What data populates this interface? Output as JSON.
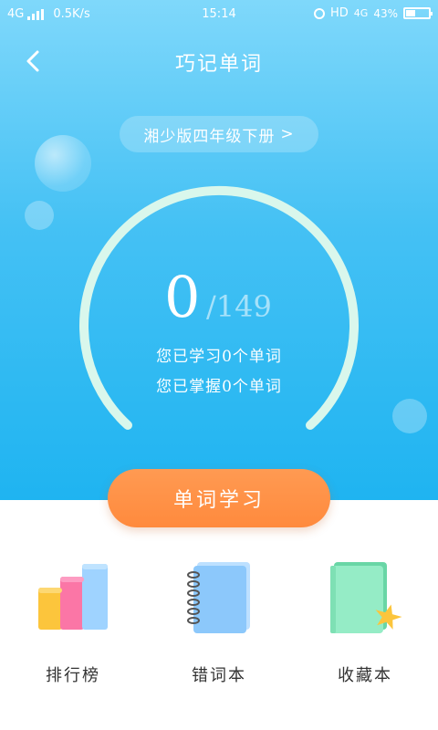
{
  "status_bar": {
    "network": "4G",
    "speed": "0.5K/s",
    "time": "15:14",
    "hd": "HD",
    "network2": "4G",
    "battery_text": "43%",
    "battery_level": 0.43
  },
  "header": {
    "title": "巧记单词"
  },
  "book_selector": {
    "label": "湘少版四年级下册",
    "chevron": ">"
  },
  "progress": {
    "learned": "0",
    "total": "/149",
    "learned_text": "您已学习0个单词",
    "mastered_text": "您已掌握0个单词"
  },
  "actions": {
    "study_label": "单词学习"
  },
  "features": [
    {
      "label": "排行榜",
      "icon": "leaderboard-icon"
    },
    {
      "label": "错词本",
      "icon": "notebook-icon"
    },
    {
      "label": "收藏本",
      "icon": "favorites-book-icon"
    }
  ],
  "colors": {
    "bg_top": "#7fd8fb",
    "bg_bottom": "#1fb4f1",
    "accent": "#ff8a3d",
    "ring": "#d9f7ec"
  }
}
